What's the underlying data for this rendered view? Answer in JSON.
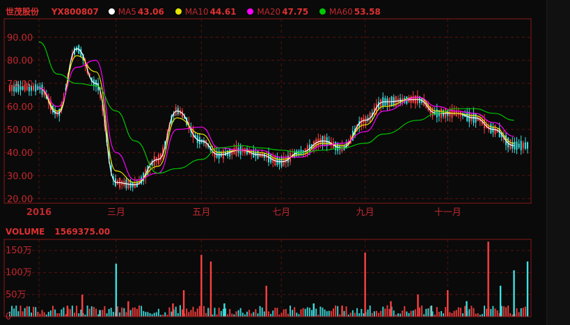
{
  "header": {
    "stock_name": "世茂股份",
    "stock_code": "YX800807",
    "ma": [
      {
        "label": "MA5",
        "value": "43.06",
        "color": "#ffffff"
      },
      {
        "label": "MA10",
        "value": "44.61",
        "color": "#e6e600"
      },
      {
        "label": "MA20",
        "value": "47.75",
        "color": "#ff00ff"
      },
      {
        "label": "MA60",
        "value": "53.58",
        "color": "#00c800"
      }
    ]
  },
  "volume_header": {
    "label": "VOLUME",
    "value": "1569375.00"
  },
  "colors": {
    "up": "#ff4040",
    "down": "#40e0e0",
    "frame": "#8a1818",
    "grid": "#5a1010",
    "axis_text": "#c0282e"
  },
  "chart_data": [
    {
      "type": "candlestick",
      "title": "",
      "x_ticks": [
        "2016",
        "三月",
        "五月",
        "七月",
        "九月",
        "十一月"
      ],
      "x_tick_dates": [
        "2016-01-04",
        "2016-03-01",
        "2016-05-03",
        "2016-07-01",
        "2016-09-01",
        "2016-11-01"
      ],
      "y_ticks": [
        "20.00",
        "30.00",
        "40.00",
        "50.00",
        "60.00",
        "70.00",
        "80.00",
        "90.00"
      ],
      "ylim": [
        18,
        98
      ],
      "grid": true,
      "series": [
        {
          "name": "MA5",
          "color": "#ffffff",
          "x": [
            "2016-01-04",
            "2016-01-18",
            "2016-02-01",
            "2016-02-15",
            "2016-03-01",
            "2016-03-15",
            "2016-04-01",
            "2016-04-15",
            "2016-05-03",
            "2016-05-16",
            "2016-06-01",
            "2016-06-15",
            "2016-07-01",
            "2016-07-15",
            "2016-08-01",
            "2016-08-15",
            "2016-09-01",
            "2016-09-15",
            "2016-10-10",
            "2016-10-24",
            "2016-11-07",
            "2016-11-21",
            "2016-12-05",
            "2016-12-20"
          ],
          "values": [
            68,
            57,
            85,
            70,
            27,
            26,
            37,
            58,
            45,
            39,
            41,
            39,
            36,
            40,
            45,
            42,
            54,
            62,
            63,
            57,
            57,
            55,
            50,
            43
          ]
        },
        {
          "name": "MA10",
          "color": "#e6e600",
          "x": [
            "2016-01-04",
            "2016-01-18",
            "2016-02-01",
            "2016-02-15",
            "2016-03-01",
            "2016-03-15",
            "2016-04-01",
            "2016-04-15",
            "2016-05-03",
            "2016-05-16",
            "2016-06-01",
            "2016-06-15",
            "2016-07-01",
            "2016-07-15",
            "2016-08-01",
            "2016-08-15",
            "2016-09-01",
            "2016-09-15",
            "2016-10-10",
            "2016-10-24",
            "2016-11-07",
            "2016-11-21",
            "2016-12-05",
            "2016-12-20"
          ],
          "values": [
            68,
            58,
            82,
            75,
            32,
            27,
            34,
            55,
            48,
            40,
            41,
            40,
            37,
            39,
            44,
            43,
            52,
            60,
            64,
            58,
            57,
            56,
            51,
            44
          ]
        },
        {
          "name": "MA20",
          "color": "#ff00ff",
          "x": [
            "2016-01-04",
            "2016-01-18",
            "2016-02-01",
            "2016-02-15",
            "2016-03-01",
            "2016-03-15",
            "2016-04-01",
            "2016-04-15",
            "2016-05-03",
            "2016-05-16",
            "2016-06-01",
            "2016-06-15",
            "2016-07-01",
            "2016-07-15",
            "2016-08-01",
            "2016-08-15",
            "2016-09-01",
            "2016-09-15",
            "2016-10-10",
            "2016-10-24",
            "2016-11-07",
            "2016-11-21",
            "2016-12-05",
            "2016-12-20"
          ],
          "values": [
            68,
            60,
            77,
            80,
            40,
            28,
            31,
            50,
            51,
            42,
            41,
            41,
            38,
            38,
            43,
            44,
            49,
            58,
            64,
            60,
            58,
            57,
            53,
            47
          ]
        },
        {
          "name": "MA60",
          "color": "#00c800",
          "x": [
            "2016-01-04",
            "2016-01-18",
            "2016-02-01",
            "2016-02-15",
            "2016-03-01",
            "2016-03-15",
            "2016-04-01",
            "2016-04-15",
            "2016-05-03",
            "2016-05-16",
            "2016-06-01",
            "2016-06-15",
            "2016-07-01",
            "2016-07-15",
            "2016-08-01",
            "2016-08-15",
            "2016-09-01",
            "2016-09-15",
            "2016-10-10",
            "2016-10-24",
            "2016-11-07",
            "2016-11-21",
            "2016-12-05",
            "2016-12-20"
          ],
          "values": [
            88,
            74,
            70,
            69,
            58,
            45,
            31,
            33,
            37,
            42,
            43,
            42,
            41,
            40,
            41,
            42,
            44,
            48,
            54,
            57,
            59,
            59,
            57,
            54
          ]
        }
      ]
    },
    {
      "type": "bar",
      "title": "",
      "y_ticks": [
        "0",
        "50万",
        "100万",
        "150万"
      ],
      "ylim": [
        0,
        1750000
      ],
      "grid": true,
      "series": [
        {
          "name": "",
          "x": [
            "2016-01-25",
            "2016-02-05",
            "2016-02-18",
            "2016-03-01",
            "2016-03-10",
            "2016-04-12",
            "2016-04-20",
            "2016-05-03",
            "2016-05-10",
            "2016-05-20",
            "2016-06-20",
            "2016-07-25",
            "2016-08-15",
            "2016-09-01",
            "2016-09-20",
            "2016-10-10",
            "2016-10-20",
            "2016-11-01",
            "2016-11-15",
            "2016-12-01",
            "2016-12-10",
            "2016-12-20",
            "2016-12-30"
          ],
          "values": [
            250000,
            500000,
            150000,
            1200000,
            350000,
            300000,
            600000,
            1400000,
            1250000,
            300000,
            700000,
            300000,
            250000,
            1450000,
            350000,
            500000,
            250000,
            600000,
            350000,
            1700000,
            700000,
            1050000,
            1250000
          ],
          "colors": [
            "up",
            "up",
            "down",
            "down",
            "up",
            "up",
            "up",
            "up",
            "up",
            "down",
            "up",
            "down",
            "up",
            "up",
            "up",
            "up",
            "down",
            "up",
            "down",
            "up",
            "down",
            "down",
            "down"
          ]
        }
      ]
    }
  ]
}
